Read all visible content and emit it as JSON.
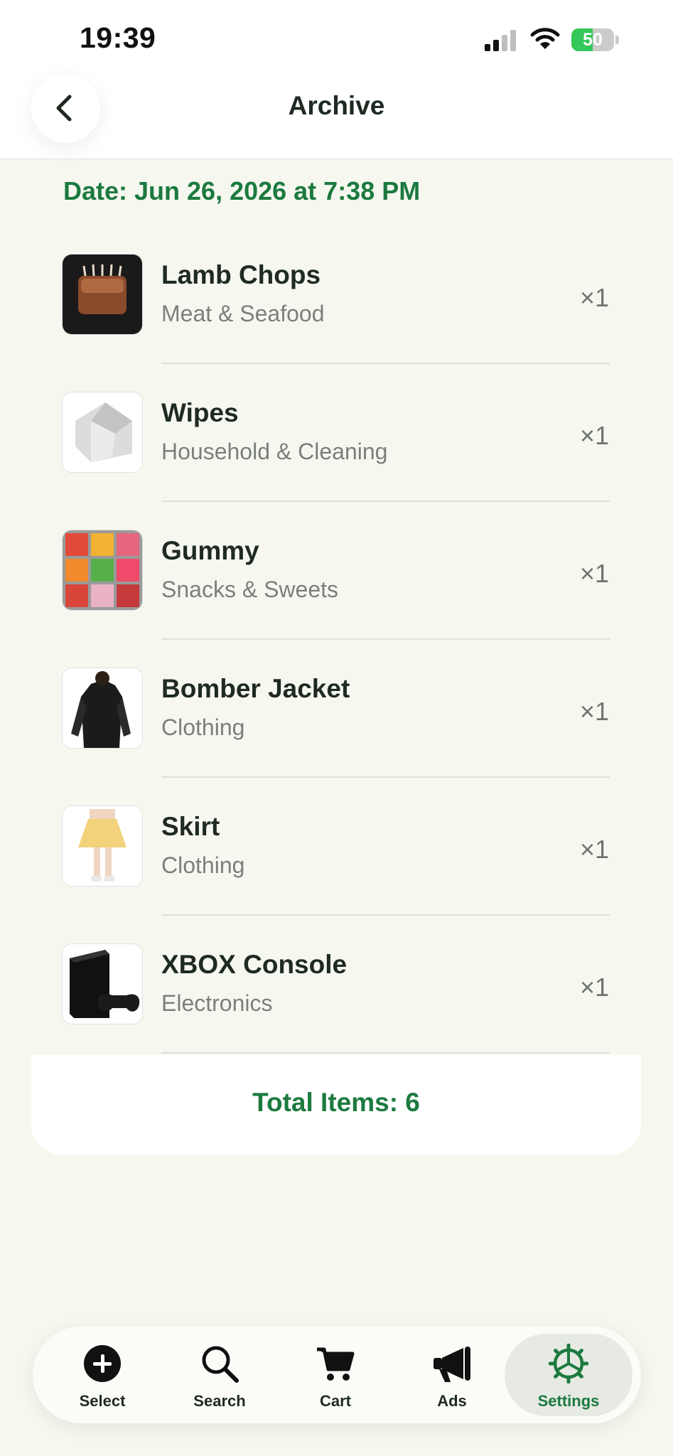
{
  "status_bar": {
    "time": "19:39",
    "battery_percent": 50,
    "battery_label": "50"
  },
  "header": {
    "title": "Archive"
  },
  "archive": {
    "date_label": "Date: Jun 26, 2026 at 7:38 PM",
    "items": [
      {
        "name": "Lamb Chops",
        "category": "Meat & Seafood",
        "qty": "×1",
        "image": "lamb-chops-image"
      },
      {
        "name": "Wipes",
        "category": "Household & Cleaning",
        "qty": "×1",
        "image": "wipes-image"
      },
      {
        "name": "Gummy",
        "category": "Snacks & Sweets",
        "qty": "×1",
        "image": "gummy-image"
      },
      {
        "name": "Bomber Jacket",
        "category": "Clothing",
        "qty": "×1",
        "image": "bomber-jacket-image"
      },
      {
        "name": "Skirt",
        "category": "Clothing",
        "qty": "×1",
        "image": "skirt-image"
      },
      {
        "name": "XBOX Console",
        "category": "Electronics",
        "qty": "×1",
        "image": "xbox-console-image"
      }
    ],
    "total_label": "Total Items: 6"
  },
  "tabbar": {
    "tabs": [
      {
        "label": "Select",
        "icon": "plus-circle-icon",
        "active": false
      },
      {
        "label": "Search",
        "icon": "search-icon",
        "active": false
      },
      {
        "label": "Cart",
        "icon": "cart-icon",
        "active": false
      },
      {
        "label": "Ads",
        "icon": "megaphone-icon",
        "active": false
      },
      {
        "label": "Settings",
        "icon": "gear-icon",
        "active": true
      }
    ]
  },
  "colors": {
    "accent": "#1c7a3f",
    "background": "#f6f8f0",
    "battery": "#34c759"
  }
}
